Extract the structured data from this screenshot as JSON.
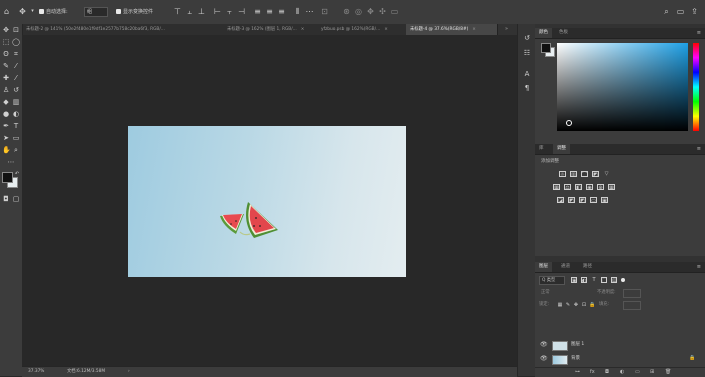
{
  "options_bar": {
    "auto_select_label": "自动选择:",
    "auto_select_target": "组",
    "show_transform_label": "显示变换控件",
    "move_icon": "move-icon"
  },
  "tabs": [
    {
      "label": "未标题-2 @ 141% (50e2f480e1f9df1e2577b758c20ba6f3, RGB/...",
      "active": false
    },
    {
      "label": "未标题-3 @ 162% (图层 1, RGB/...",
      "active": false
    },
    {
      "label": "yfzbuo.psb @ 162%(RGB/...",
      "active": false
    },
    {
      "label": "未标题-4 @ 37.6%(RGB/8#)",
      "active": true
    }
  ],
  "status": {
    "zoom": "37.37%",
    "doc": "文档:6.12M/3.58M"
  },
  "color_panel": {
    "tabs": [
      "颜色",
      "色板"
    ]
  },
  "adjust_panel": {
    "tabs": [
      "库",
      "调整"
    ],
    "title": "添加调整"
  },
  "layers_panel": {
    "tabs": [
      "图层",
      "通道",
      "路径"
    ],
    "filter_label": "Q 类型",
    "blend_mode": "正常",
    "opacity_label": "不透明度:",
    "lock_label": "锁定:",
    "fill_label": "填充:",
    "layers": [
      {
        "name": "图层 1",
        "locked": false
      },
      {
        "name": "背景",
        "locked": true
      }
    ]
  },
  "colors": {
    "fg": "#111111",
    "bg": "#e8eef0",
    "accent": "#1ea0e6"
  }
}
